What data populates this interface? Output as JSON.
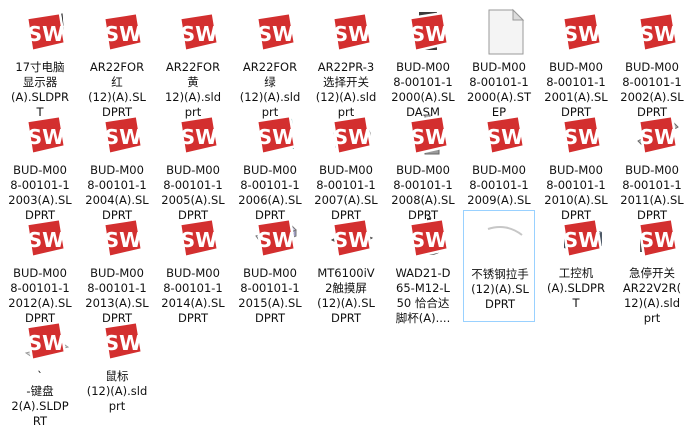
{
  "files": [
    {
      "name": "17寸电脑\n显示器\n(A).SLDPR\nT",
      "icon": "monitor-part",
      "badge": "SW"
    },
    {
      "name": "AR22FOR\n红\n(12)(A).SL\nDPRT",
      "icon": "pushbutton-part",
      "badge": "SW"
    },
    {
      "name": "AR22FOR\n黄\n12)(A).sld\nprt",
      "icon": "pushbutton-dark-part",
      "badge": "SW"
    },
    {
      "name": "AR22FOR\n绿\n(12)(A).sld\nprt",
      "icon": "pushbutton-dark-part",
      "badge": "SW"
    },
    {
      "name": "AR22PR-3\n选择开关\n(12)(A).sld\nprt",
      "icon": "selector-switch-part",
      "badge": "SW"
    },
    {
      "name": "BUD-M00\n8-00101-1\n2000(A).SL\nDASM",
      "icon": "assembly-part",
      "badge": "SW"
    },
    {
      "name": "BUD-M00\n8-00101-1\n2000(A).ST\nEP",
      "icon": "blank-file",
      "badge": ""
    },
    {
      "name": "BUD-M00\n8-00101-1\n2001(A).SL\nDPRT",
      "icon": "gray-plate-part",
      "badge": "SW"
    },
    {
      "name": "BUD-M00\n8-00101-1\n2002(A).SL\nDPRT",
      "icon": "green-board-part",
      "badge": "SW"
    },
    {
      "name": "BUD-M00\n8-00101-1\n2003(A).SL\nDPRT",
      "icon": "green-board-part",
      "badge": "SW"
    },
    {
      "name": "BUD-M00\n8-00101-1\n2004(A).SL\nDPRT",
      "icon": "gray-plate-part",
      "badge": "SW"
    },
    {
      "name": "BUD-M00\n8-00101-1\n2005(A).SL\nDPRT",
      "icon": "yellow-bracket-part",
      "badge": "SW"
    },
    {
      "name": "BUD-M00\n8-00101-1\n2006(A).SL\nDPRT",
      "icon": "teal-plate-part",
      "badge": "SW"
    },
    {
      "name": "BUD-M00\n8-00101-1\n2007(A).SL\nDPRT",
      "icon": "bracket-part",
      "badge": "SW"
    },
    {
      "name": "BUD-M00\n8-00101-1\n2008(A).SL\nDPRT",
      "icon": "rod-part",
      "badge": "SW"
    },
    {
      "name": "BUD-M00\n8-00101-1\n2009(A).SL\nDPRT",
      "icon": "green-board-part",
      "badge": "SW"
    },
    {
      "name": "BUD-M00\n8-00101-1\n2010(A).SL\nDPRT",
      "icon": "dark-block-part",
      "badge": "SW"
    },
    {
      "name": "BUD-M00\n8-00101-1\n2011(A).SL\nDPRT",
      "icon": "slot-bar-part",
      "badge": "SW"
    },
    {
      "name": "BUD-M00\n8-00101-1\n2012(A).SL\nDPRT",
      "icon": "gray-plate-part",
      "badge": "SW"
    },
    {
      "name": "BUD-M00\n8-00101-1\n2013(A).SL\nDPRT",
      "icon": "dark-block-part",
      "badge": "SW"
    },
    {
      "name": "BUD-M00\n8-00101-1\n2014(A).SL\nDPRT",
      "icon": "gray-plate-part",
      "badge": "SW"
    },
    {
      "name": "BUD-M00\n8-00101-1\n2015(A).SL\nDPRT",
      "icon": "beam-part",
      "badge": "SW"
    },
    {
      "name": "MT6100iV\n2触摸屏\n(12)(A).SL\nDPRT",
      "icon": "touchscreen-part",
      "badge": "SW"
    },
    {
      "name": "WAD21-D\n65-M12-L\n50 恰合达\n脚杯(A)....",
      "icon": "foot-cup-part",
      "badge": "SW"
    },
    {
      "name": "不锈钢拉手\n(12)(A).SL\nDPRT",
      "icon": "handle-part",
      "badge": ""
    },
    {
      "name": "工控机\n(A).SLDPR\nT",
      "icon": "industrial-pc-part",
      "badge": "SW"
    },
    {
      "name": "急停开关\nAR22V2R(\n12)(A).sld\nprt",
      "icon": "estop-part",
      "badge": "SW"
    },
    {
      "name": "`\n-键盘\n2(A).SLDP\nRT",
      "icon": "keyboard-part",
      "badge": "SW"
    },
    {
      "name": "鼠标\n(12)(A).sld\nprt",
      "icon": "mouse-part",
      "badge": "SW"
    }
  ],
  "selected_index": 24
}
